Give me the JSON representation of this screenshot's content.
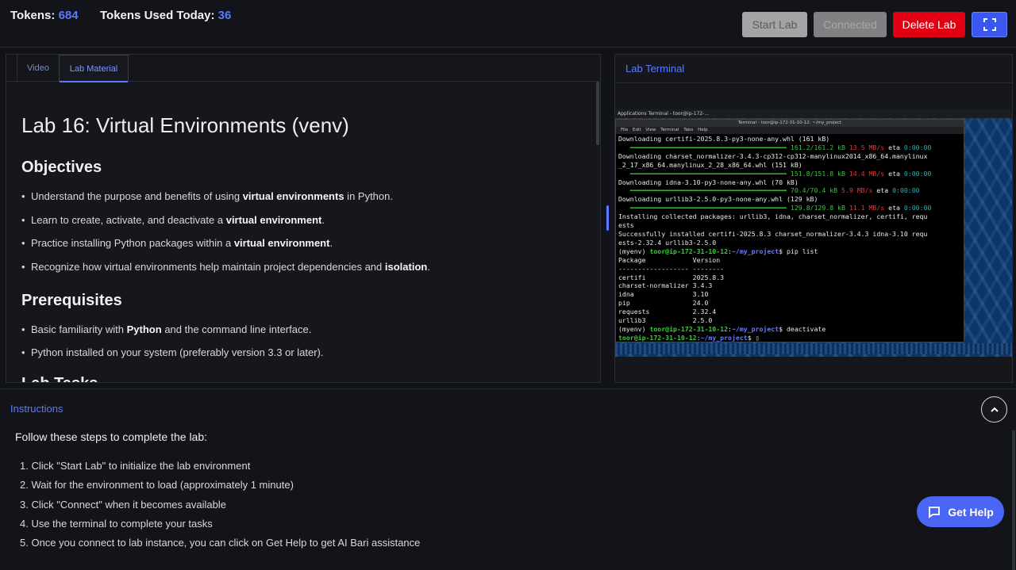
{
  "header": {
    "tokens_label": "Tokens:",
    "tokens_value": "684",
    "used_label": "Tokens Used Today:",
    "used_value": "36",
    "buttons": {
      "start": "Start Lab",
      "connected": "Connected",
      "delete": "Delete Lab",
      "fullscreen_icon": "fullscreen-icon"
    }
  },
  "lab": {
    "tabs": [
      "Video",
      "Lab Material"
    ],
    "active_tab": "Lab Material",
    "title": "Lab 16: Virtual Environments (venv)",
    "objectives_heading": "Objectives",
    "objectives": [
      {
        "pre": "Understand the purpose and benefits of using ",
        "bold": "virtual environments",
        "post": " in Python."
      },
      {
        "pre": "Learn to create, activate, and deactivate a ",
        "bold": "virtual environment",
        "post": "."
      },
      {
        "pre": "Practice installing Python packages within a ",
        "bold": "virtual environment",
        "post": "."
      },
      {
        "pre": "Recognize how virtual environments help maintain project dependencies and ",
        "bold": "isolation",
        "post": "."
      }
    ],
    "prereq_heading": "Prerequisites",
    "prerequisites": [
      {
        "pre": "Basic familiarity with ",
        "bold": "Python",
        "post": " and the command line interface."
      },
      {
        "pre": "Python installed on your system (preferably version 3.3 or later).",
        "bold": "",
        "post": ""
      }
    ],
    "next_heading_partial": "Lab Tasks"
  },
  "terminal": {
    "panel_title": "Lab Terminal",
    "taskbar_text": "Applications   Terminal - toor@ip-172-...",
    "window_title": "Terminal - toor@ip-172-31-10-12: ~/my_project",
    "menu": [
      "File",
      "Edit",
      "View",
      "Terminal",
      "Tabs",
      "Help"
    ]
  },
  "instructions": {
    "title": "Instructions",
    "lead": "Follow these steps to complete the lab:",
    "steps": [
      "1. Click \"Start Lab\" to initialize the lab environment",
      "2. Wait for the environment to load (approximately 1 minute)",
      "3. Click \"Connect\" when it becomes available",
      "4. Use the terminal to complete your tasks",
      "5. Once you connect to lab instance, you can click on Get Help to get AI Bari assistance"
    ]
  },
  "help_button": "Get Help",
  "colors": {
    "accent": "#5a7bff",
    "danger": "#e00012",
    "background": "#111318"
  }
}
